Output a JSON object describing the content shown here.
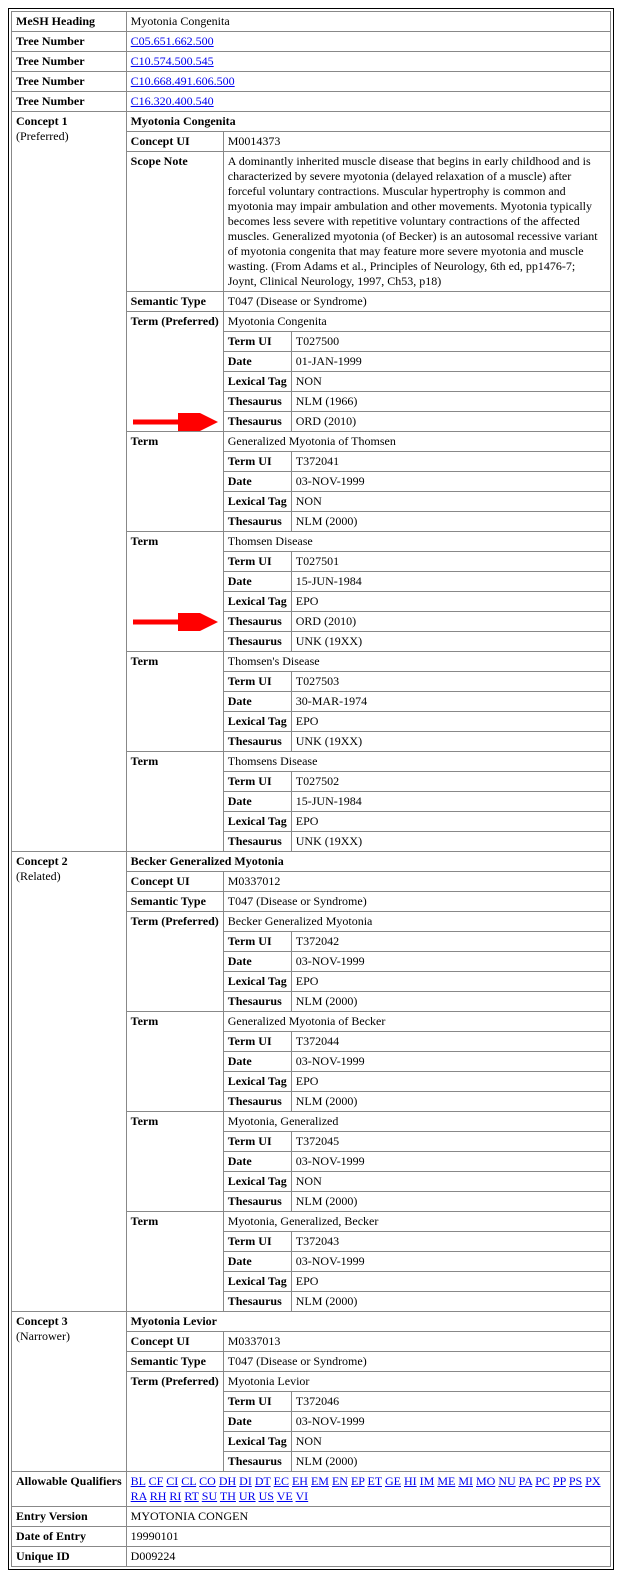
{
  "mesh_heading_label": "MeSH Heading",
  "mesh_heading_value": "Myotonia Congenita",
  "tree_number_label": "Tree Number",
  "tree_numbers": [
    "C05.651.662.500",
    "C10.574.500.545",
    "C10.668.491.606.500",
    "C16.320.400.540"
  ],
  "concept_label": "Concept",
  "concept1": {
    "rel": "(Preferred)",
    "name": "Myotonia Congenita",
    "concept_ui_label": "Concept UI",
    "concept_ui": "M0014373",
    "scope_note_label": "Scope Note",
    "scope_note": "A dominantly inherited muscle disease that begins in early childhood and is characterized by severe myotonia (delayed relaxation of a muscle) after forceful voluntary contractions. Muscular hypertrophy is common and myotonia may impair ambulation and other movements. Myotonia typically becomes less severe with repetitive voluntary contractions of the affected muscles. Generalized myotonia (of Becker) is an autosomal recessive variant of myotonia congenita that may feature more severe myotonia and muscle wasting. (From Adams et al., Principles of Neurology, 6th ed, pp1476-7; Joynt, Clinical Neurology, 1997, Ch53, p18)",
    "semantic_type_label": "Semantic Type",
    "semantic_type": "T047 (Disease or Syndrome)",
    "term_label": "Term",
    "term_preferred_label": "Term (Preferred)",
    "terms": [
      {
        "preferred": true,
        "name": "Myotonia Congenita",
        "rows": [
          [
            "Term UI",
            "T027500"
          ],
          [
            "Date",
            "01-JAN-1999"
          ],
          [
            "Lexical Tag",
            "NON"
          ],
          [
            "Thesaurus",
            "NLM (1966)"
          ],
          [
            "Thesaurus",
            "ORD (2010)"
          ]
        ]
      },
      {
        "preferred": false,
        "name": "Generalized Myotonia of Thomsen",
        "rows": [
          [
            "Term UI",
            "T372041"
          ],
          [
            "Date",
            "03-NOV-1999"
          ],
          [
            "Lexical Tag",
            "NON"
          ],
          [
            "Thesaurus",
            "NLM (2000)"
          ]
        ]
      },
      {
        "preferred": false,
        "name": "Thomsen Disease",
        "rows": [
          [
            "Term UI",
            "T027501"
          ],
          [
            "Date",
            "15-JUN-1984"
          ],
          [
            "Lexical Tag",
            "EPO"
          ],
          [
            "Thesaurus",
            "ORD (2010)"
          ],
          [
            "Thesaurus",
            "UNK (19XX)"
          ]
        ]
      },
      {
        "preferred": false,
        "name": "Thomsen's Disease",
        "rows": [
          [
            "Term UI",
            "T027503"
          ],
          [
            "Date",
            "30-MAR-1974"
          ],
          [
            "Lexical Tag",
            "EPO"
          ],
          [
            "Thesaurus",
            "UNK (19XX)"
          ]
        ]
      },
      {
        "preferred": false,
        "name": "Thomsens Disease",
        "rows": [
          [
            "Term UI",
            "T027502"
          ],
          [
            "Date",
            "15-JUN-1984"
          ],
          [
            "Lexical Tag",
            "EPO"
          ],
          [
            "Thesaurus",
            "UNK (19XX)"
          ]
        ]
      }
    ]
  },
  "concept2": {
    "rel": "(Related)",
    "name": "Becker Generalized Myotonia",
    "concept_ui": "M0337012",
    "semantic_type": "T047 (Disease or Syndrome)",
    "terms": [
      {
        "preferred": true,
        "name": "Becker Generalized Myotonia",
        "rows": [
          [
            "Term UI",
            "T372042"
          ],
          [
            "Date",
            "03-NOV-1999"
          ],
          [
            "Lexical Tag",
            "EPO"
          ],
          [
            "Thesaurus",
            "NLM (2000)"
          ]
        ]
      },
      {
        "preferred": false,
        "name": "Generalized Myotonia of Becker",
        "rows": [
          [
            "Term UI",
            "T372044"
          ],
          [
            "Date",
            "03-NOV-1999"
          ],
          [
            "Lexical Tag",
            "EPO"
          ],
          [
            "Thesaurus",
            "NLM (2000)"
          ]
        ]
      },
      {
        "preferred": false,
        "name": "Myotonia, Generalized",
        "rows": [
          [
            "Term UI",
            "T372045"
          ],
          [
            "Date",
            "03-NOV-1999"
          ],
          [
            "Lexical Tag",
            "NON"
          ],
          [
            "Thesaurus",
            "NLM (2000)"
          ]
        ]
      },
      {
        "preferred": false,
        "name": "Myotonia, Generalized, Becker",
        "rows": [
          [
            "Term UI",
            "T372043"
          ],
          [
            "Date",
            "03-NOV-1999"
          ],
          [
            "Lexical Tag",
            "EPO"
          ],
          [
            "Thesaurus",
            "NLM (2000)"
          ]
        ]
      }
    ]
  },
  "concept3": {
    "rel": "(Narrower)",
    "name": "Myotonia Levior",
    "concept_ui": "M0337013",
    "semantic_type": "T047 (Disease or Syndrome)",
    "terms": [
      {
        "preferred": true,
        "name": "Myotonia Levior",
        "rows": [
          [
            "Term UI",
            "T372046"
          ],
          [
            "Date",
            "03-NOV-1999"
          ],
          [
            "Lexical Tag",
            "NON"
          ],
          [
            "Thesaurus",
            "NLM (2000)"
          ]
        ]
      }
    ]
  },
  "allowable_qualifiers_label": "Allowable Qualifiers",
  "allowable_qualifiers": [
    "BL",
    "CF",
    "CI",
    "CL",
    "CO",
    "DH",
    "DI",
    "DT",
    "EC",
    "EH",
    "EM",
    "EN",
    "EP",
    "ET",
    "GE",
    "HI",
    "IM",
    "ME",
    "MI",
    "MO",
    "NU",
    "PA",
    "PC",
    "PP",
    "PS",
    "PX",
    "RA",
    "RH",
    "RI",
    "RT",
    "SU",
    "TH",
    "UR",
    "US",
    "VE",
    "VI"
  ],
  "entry_version_label": "Entry Version",
  "entry_version": "MYOTONIA CONGEN",
  "date_of_entry_label": "Date of Entry",
  "date_of_entry": "19990101",
  "unique_id_label": "Unique ID",
  "unique_id": "D009224"
}
